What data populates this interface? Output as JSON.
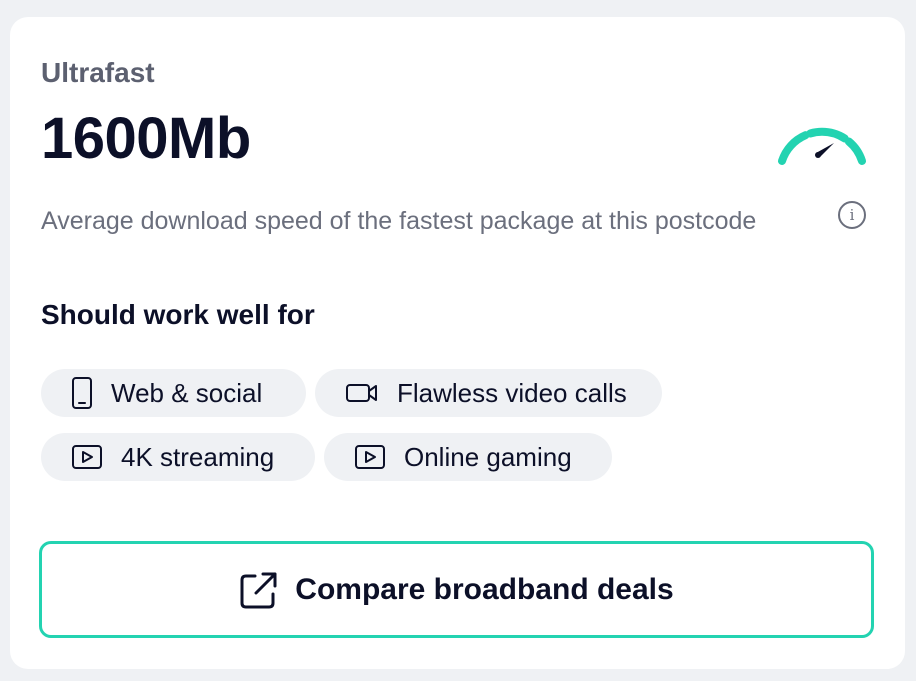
{
  "card": {
    "tier": "Ultrafast",
    "speed": "1600Mb",
    "description": "Average download speed of the fastest package at this postcode",
    "info_glyph": "i",
    "gauge_icon": "speedometer-icon",
    "accent_color": "#23d3b1"
  },
  "uses": {
    "heading": "Should work well for",
    "items": [
      {
        "label": "Web & social",
        "icon": "smartphone-icon"
      },
      {
        "label": "Flawless video calls",
        "icon": "video-camera-icon"
      },
      {
        "label": "4K streaming",
        "icon": "play-icon"
      },
      {
        "label": "Online gaming",
        "icon": "play-icon"
      }
    ]
  },
  "cta": {
    "label": "Compare broadband deals",
    "icon": "external-link-icon"
  }
}
